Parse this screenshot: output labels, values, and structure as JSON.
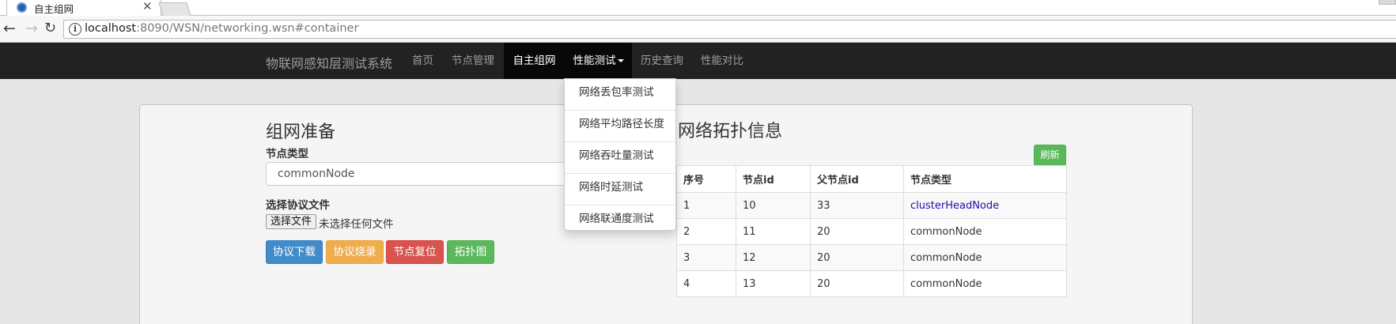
{
  "browser": {
    "tab_title": "自主组网",
    "tab_close": "✕",
    "url_host": "localhost",
    "url_rest": ":8090/WSN/networking.wsn#container",
    "back_icon": "←",
    "forward_icon": "→",
    "reload_icon": "↻",
    "info_icon": "i"
  },
  "navbar": {
    "brand": "物联网感知层测试系统",
    "items": [
      {
        "label": "首页"
      },
      {
        "label": "节点管理"
      },
      {
        "label": "自主组网"
      },
      {
        "label": "性能测试"
      },
      {
        "label": "历史查询"
      },
      {
        "label": "性能对比"
      }
    ],
    "active_item": "自主组网",
    "open_item": "性能测试"
  },
  "dropdown": {
    "items": [
      {
        "label": "网络丢包率测试"
      },
      {
        "label": "网络平均路径长度"
      },
      {
        "label": "网络吞吐量测试"
      },
      {
        "label": "网络时延测试"
      },
      {
        "label": "网络联通度测试"
      }
    ]
  },
  "left": {
    "heading": "组网准备",
    "node_type_label": "节点类型",
    "node_type_value": "commonNode",
    "protocol_file_label": "选择协议文件",
    "choose_file_button": "选择文件",
    "no_file_text": "未选择任何文件",
    "buttons": {
      "download": "协议下载",
      "burn": "协议烧录",
      "reset": "节点复位",
      "topology": "拓扑图"
    }
  },
  "right": {
    "heading": "网络拓扑信息",
    "refresh_button": "刷新",
    "table": {
      "headers": [
        "序号",
        "节点id",
        "父节点id",
        "节点类型"
      ],
      "rows": [
        [
          "1",
          "10",
          "33",
          "clusterHeadNode"
        ],
        [
          "2",
          "11",
          "20",
          "commonNode"
        ],
        [
          "3",
          "12",
          "20",
          "commonNode"
        ],
        [
          "4",
          "13",
          "20",
          "commonNode"
        ]
      ]
    }
  },
  "colors": {
    "navbar_bg": "#222222",
    "navbar_active_bg": "#080808",
    "primary": "#428bca",
    "warning": "#f0ad4e",
    "danger": "#d9534f",
    "success": "#5cb85c",
    "link": "#1a0dab"
  }
}
